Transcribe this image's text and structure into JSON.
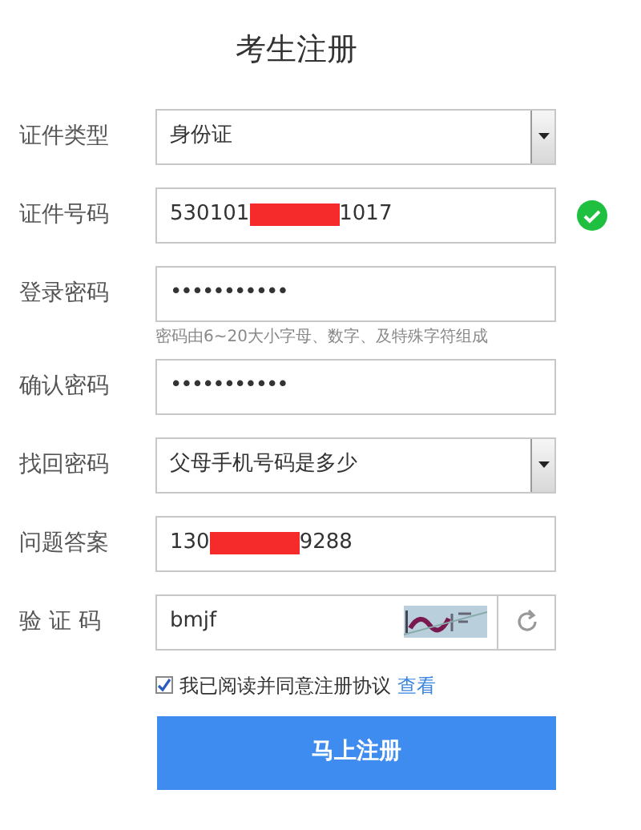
{
  "title": "考生注册",
  "fields": [
    {
      "kind": "select",
      "label": "证件类型",
      "value": "身份证"
    },
    {
      "kind": "text",
      "label": "证件号码",
      "value_before": "530101",
      "redacted": true,
      "value_after": "1017",
      "valid": true
    },
    {
      "kind": "text",
      "label": "登录密码",
      "value_before": "•••••••••••",
      "hint": "密码由6~20大小字母、数字、及特殊字符组成"
    },
    {
      "kind": "text",
      "label": "确认密码",
      "value_before": "•••••••••••"
    },
    {
      "kind": "select",
      "label": "找回密码",
      "value": "父母手机号码是多少"
    },
    {
      "kind": "text",
      "label": "问题答案",
      "value_before": "130",
      "redacted": true,
      "value_after": "9288"
    },
    {
      "kind": "captcha",
      "label": "验 证 码",
      "value": "bmjf"
    }
  ],
  "agreement": {
    "checked": true,
    "text": "我已阅读并同意注册协议",
    "link": "查看"
  },
  "submit": "马上注册"
}
